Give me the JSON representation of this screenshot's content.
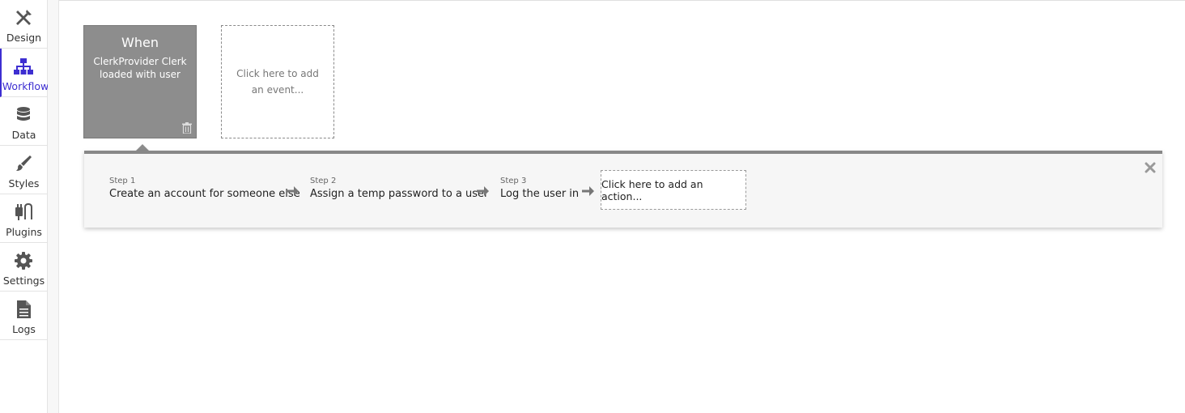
{
  "sidebar": {
    "items": [
      {
        "label": "Design",
        "icon": "design-icon"
      },
      {
        "label": "Workflow",
        "icon": "workflow-icon",
        "active": true
      },
      {
        "label": "Data",
        "icon": "database-icon"
      },
      {
        "label": "Styles",
        "icon": "brush-icon"
      },
      {
        "label": "Plugins",
        "icon": "plug-icon"
      },
      {
        "label": "Settings",
        "icon": "gear-icon"
      },
      {
        "label": "Logs",
        "icon": "document-icon"
      }
    ],
    "active_color": "#3d2ed1"
  },
  "event": {
    "title": "When",
    "description": "ClerkProvider Clerk loaded with user"
  },
  "add_event": {
    "label": "Click here to add an event..."
  },
  "actions": {
    "steps": [
      {
        "number": "Step 1",
        "name": "Create an account for someone else"
      },
      {
        "number": "Step 2",
        "name": "Assign a temp password to a user"
      },
      {
        "number": "Step 3",
        "name": "Log the user in"
      }
    ],
    "add_label": "Click here to add an action..."
  },
  "colors": {
    "event_card": "#8d8d8d",
    "panel_border": "#888888"
  }
}
